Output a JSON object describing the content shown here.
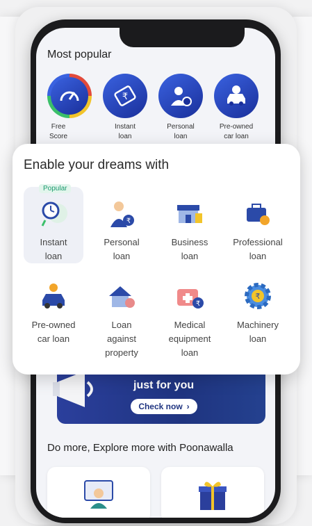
{
  "most_popular": {
    "title": "Most popular",
    "items": [
      {
        "label": "Free\nScore",
        "icon": "speedometer-icon"
      },
      {
        "label": "Instant\nloan",
        "icon": "rupee-notes-icon"
      },
      {
        "label": "Personal\nloan",
        "icon": "person-money-icon"
      },
      {
        "label": "Pre-owned\ncar loan",
        "icon": "car-rupee-icon"
      }
    ]
  },
  "popup": {
    "title": "Enable your dreams with",
    "badge": "Popular",
    "items": [
      {
        "label": "Instant\nloan",
        "icon": "stopwatch-icon"
      },
      {
        "label": "Personal\nloan",
        "icon": "person-money-bag-icon"
      },
      {
        "label": "Business\nloan",
        "icon": "shop-icon"
      },
      {
        "label": "Professional\nloan",
        "icon": "briefcase-icon"
      },
      {
        "label": "Pre-owned\ncar loan",
        "icon": "car-coin-icon"
      },
      {
        "label": "Loan\nagainst\nproperty",
        "icon": "house-icon"
      },
      {
        "label": "Medical\nequipment\nloan",
        "icon": "medical-kit-icon"
      },
      {
        "label": "Machinery\nloan",
        "icon": "gear-rupee-icon"
      }
    ]
  },
  "banner": {
    "text": "just for you",
    "button": "Check now"
  },
  "explore": {
    "title": "Do more, Explore more with Poonawalla"
  },
  "colors": {
    "brand_blue": "#1f3480",
    "badge_green": "#1c9a6e"
  }
}
